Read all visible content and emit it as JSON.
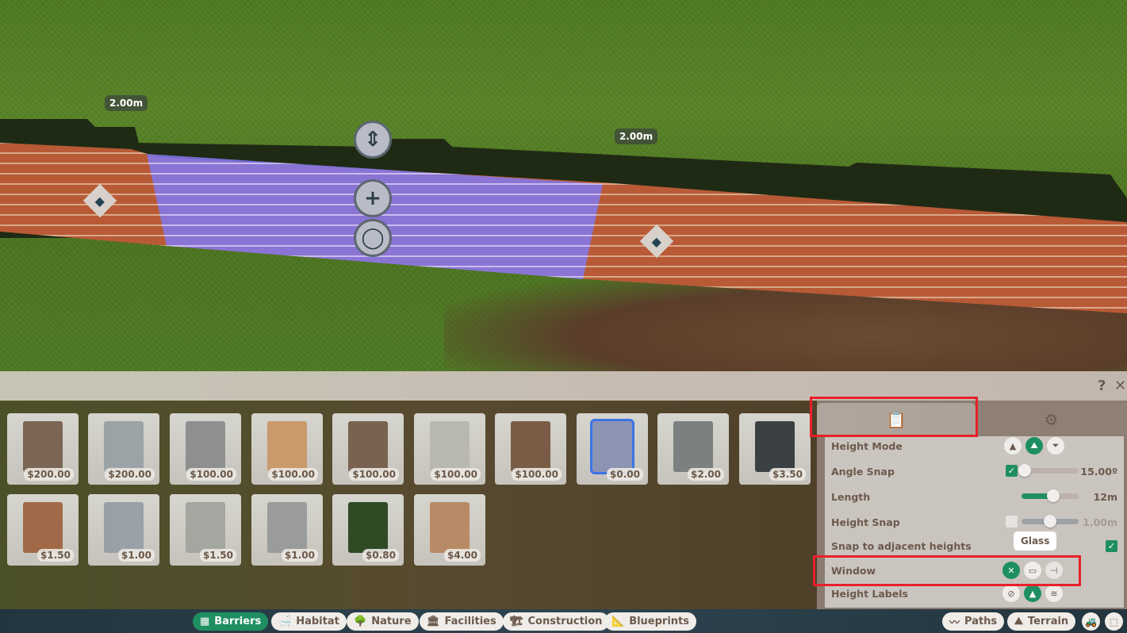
{
  "scene": {
    "measurements": [
      "2.00m",
      "2.00m"
    ],
    "gizmos": {
      "height_adjust_icon": "⇕",
      "add_icon": "+",
      "rotate_icon": "◯"
    },
    "edge_handle_icon": "◆"
  },
  "toolbar": {
    "help_label": "?",
    "close_label": "✕"
  },
  "catalog": {
    "items": [
      {
        "price": "$200.00",
        "color": "#7a6652"
      },
      {
        "price": "$200.00",
        "color": "#9ca3a6"
      },
      {
        "price": "$100.00",
        "color": "#8e9090"
      },
      {
        "price": "$100.00",
        "color": "#c89a6c"
      },
      {
        "price": "$100.00",
        "color": "#7a6250"
      },
      {
        "price": "$100.00",
        "color": "#b8b8ae"
      },
      {
        "price": "$100.00",
        "color": "#7a5c46"
      },
      {
        "price": "$0.00",
        "color": "#8c94b4",
        "selected": true
      },
      {
        "price": "$2.00",
        "color": "#7d8080"
      },
      {
        "price": "$3.50",
        "color": "#3a4044"
      },
      {
        "price": "$1.50",
        "color": "#a06a48"
      },
      {
        "price": "$1.00",
        "color": "#9aa0a8"
      },
      {
        "price": "$1.50",
        "color": "#a6a6a0"
      },
      {
        "price": "$1.00",
        "color": "#9a9c9c"
      },
      {
        "price": "$0.80",
        "color": "#2f4a24"
      },
      {
        "price": "$4.00",
        "color": "#b88a66"
      }
    ]
  },
  "panel": {
    "tabs": [
      {
        "name": "info",
        "icon": "📋",
        "active": true
      },
      {
        "name": "settings",
        "icon": "⚙",
        "active": false
      }
    ],
    "options": {
      "height_mode": {
        "label": "Height Mode",
        "buttons": [
          "▲",
          "⛰",
          "⏷"
        ],
        "selected": 1
      },
      "angle_snap": {
        "label": "Angle Snap",
        "enabled": true,
        "value": "15.00º",
        "fraction": 0.05
      },
      "length": {
        "label": "Length",
        "value": "12m",
        "fraction": 0.55
      },
      "height_snap": {
        "label": "Height Snap",
        "enabled": false,
        "value": "1.00m",
        "fraction": 0.5
      },
      "snap_adjacent": {
        "label": "Snap to adjacent heights",
        "enabled": true
      },
      "window": {
        "label": "Window",
        "buttons": [
          "✕",
          "▭",
          "⊣"
        ],
        "selected": 0,
        "tooltip": "Glass"
      },
      "height_labels": {
        "label": "Height Labels",
        "buttons": [
          "⊘",
          "▲",
          "≋"
        ],
        "selected": 1
      }
    }
  },
  "bottom_bar": {
    "left": [
      {
        "label": "Barriers",
        "icon": "▦",
        "active": true
      },
      {
        "label": "Habitat",
        "icon": "🛁",
        "active": false
      },
      {
        "label": "Nature",
        "icon": "🌳",
        "active": false
      },
      {
        "label": "Facilities",
        "icon": "🏛",
        "active": false
      },
      {
        "label": "Construction",
        "icon": "🏗",
        "active": false
      },
      {
        "label": "Blueprints",
        "icon": "📐",
        "active": false
      }
    ],
    "right": [
      {
        "label": "Paths",
        "icon": "〰"
      },
      {
        "label": "Terrain",
        "icon": "⛰"
      }
    ],
    "extra_icons": [
      "🚜",
      "⬚"
    ]
  },
  "colors": {
    "accent": "#1f8f62",
    "highlight": "#e8202a",
    "selection": "#3b74e6"
  }
}
